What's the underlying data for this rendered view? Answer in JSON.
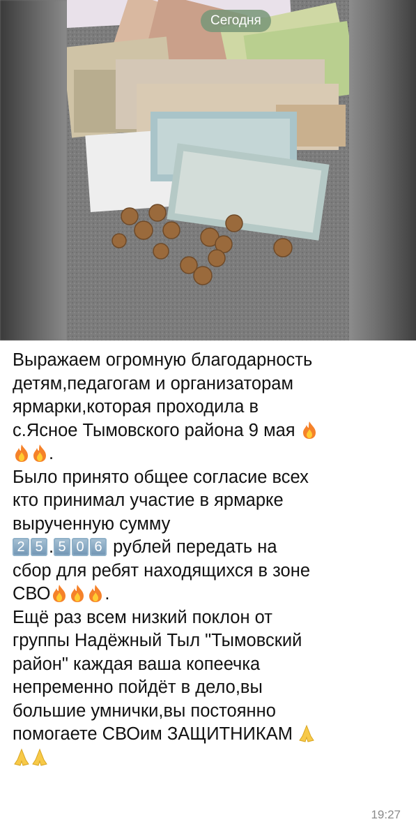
{
  "chat": {
    "date_label": "Сегодня",
    "time": "19:27",
    "message": {
      "line1": "Выражаем огромную благодарность",
      "line2": "детям,педагогам и организаторам",
      "line3": "ярмарки,которая проходила в",
      "line4": "с.Ясное Тымовского района 9 мая",
      "line6": "Было принято общее согласие всех",
      "line7": "кто принимал участие в ярмарке",
      "line8": "вырученную сумму",
      "amount_digits_a": [
        "2",
        "5"
      ],
      "amount_sep": ".",
      "amount_digits_b": [
        "5",
        "0",
        "6"
      ],
      "line9_rest": " рублей передать на",
      "line10": "сбор для ребят находящихся в зоне",
      "line11": "СВО",
      "line12": "Ещё раз всем низкий поклон от",
      "line13": "группы Надёжный Тыл \"Тымовский",
      "line14": "район\" каждая ваша копеечка",
      "line15": "непременно пойдёт в дело,вы",
      "line16": "большие умнички,вы постоянно",
      "line17": "помогаете СВОим ЗАЩИТНИКАМ",
      "period": "."
    }
  },
  "icons": {
    "fire": "fire-emoji-icon",
    "pray": "folded-hands-emoji-icon"
  },
  "colors": {
    "text": "#111111",
    "timestamp": "#8a8a8a",
    "date_pill": "#789678"
  }
}
